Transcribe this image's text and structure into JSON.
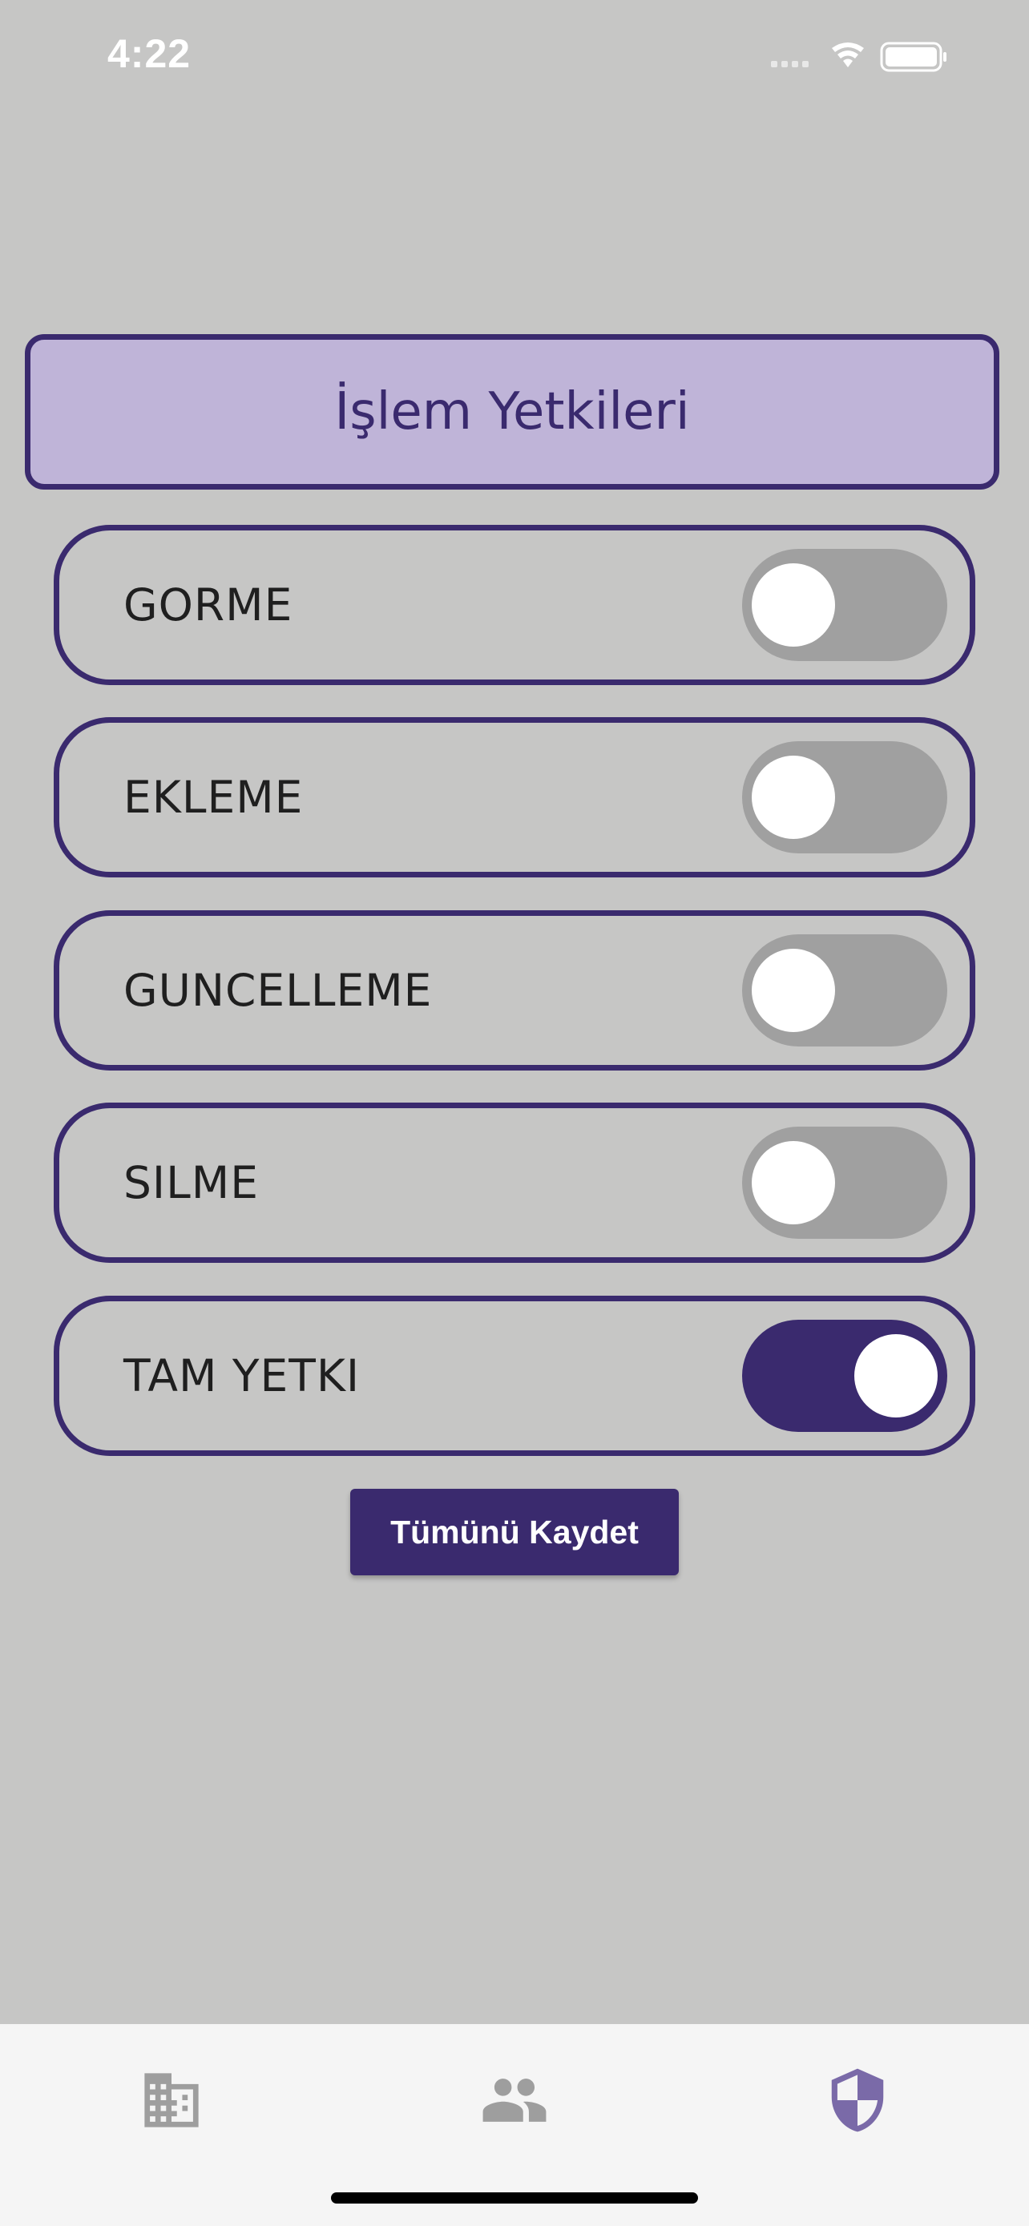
{
  "status_bar": {
    "time": "4:22"
  },
  "title": "İşlem Yetkileri",
  "permissions": [
    {
      "label": "GORME",
      "enabled": false
    },
    {
      "label": "EKLEME",
      "enabled": false
    },
    {
      "label": "GUNCELLEME",
      "enabled": false
    },
    {
      "label": "SILME",
      "enabled": false
    },
    {
      "label": "TAM YETKI",
      "enabled": true
    }
  ],
  "save_button": {
    "label": "Tümünü Kaydet"
  },
  "bottom_nav": {
    "items": [
      {
        "icon": "building-icon",
        "active": false
      },
      {
        "icon": "people-icon",
        "active": false
      },
      {
        "icon": "shield-icon",
        "active": true
      }
    ]
  },
  "colors": {
    "accent": "#3a2a6e",
    "title_background": "#bfb4d8",
    "page_background": "#c6c6c5",
    "toggle_off": "#a0a0a0",
    "nav_inactive": "#9e9e9e",
    "nav_active": "#7a6aa8"
  }
}
